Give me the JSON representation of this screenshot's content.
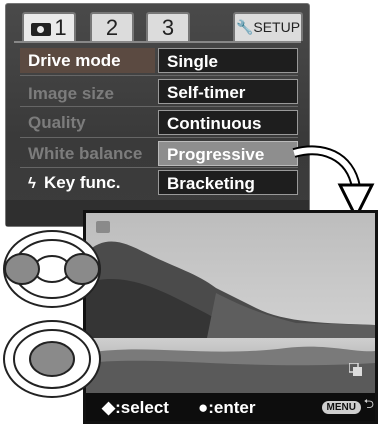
{
  "tabs": [
    {
      "label": "1",
      "icon": "camera-icon",
      "active": true
    },
    {
      "label": "2"
    },
    {
      "label": "3"
    },
    {
      "label": "SETUP",
      "icon": "wrench-icon"
    }
  ],
  "menu_items": [
    {
      "label": "Drive mode",
      "selected": true
    },
    {
      "label": "Image size"
    },
    {
      "label": "Quality"
    },
    {
      "label": "White balance"
    },
    {
      "label": "Key func.",
      "icon": "flash-icon"
    }
  ],
  "options": [
    {
      "label": "Single"
    },
    {
      "label": "Self-timer"
    },
    {
      "label": "Continuous"
    },
    {
      "label": "Progressive",
      "highlighted": true
    },
    {
      "label": "Bracketing"
    }
  ],
  "footer": {
    "select_label": "◆:select",
    "enter_label": "●:enter",
    "menu_badge": "MENU",
    "back_symbol": "⮌"
  },
  "colors": {
    "selected_item": "#5b4a41",
    "highlighted_option": "#8e8e8e",
    "menu_bg": "#444444"
  }
}
